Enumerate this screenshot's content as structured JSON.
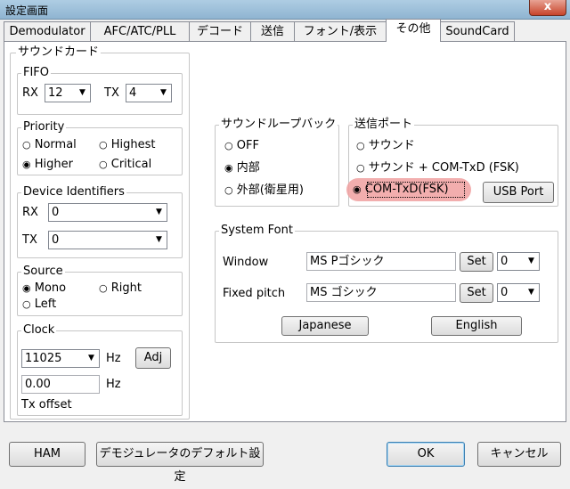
{
  "window": {
    "title": "設定画面",
    "close_glyph": "x"
  },
  "tabs": [
    "Demodulator",
    "AFC/ATC/PLL",
    "デコード",
    "送信",
    "フォント/表示",
    "その他",
    "SoundCard"
  ],
  "sound_card": {
    "legend": "サウンドカード",
    "fifo": {
      "legend": "FIFO",
      "rx_label": "RX",
      "rx_value": "12",
      "tx_label": "TX",
      "tx_value": "4"
    },
    "priority": {
      "legend": "Priority",
      "options": [
        "Normal",
        "Highest",
        "Higher",
        "Critical"
      ],
      "selected": "Higher"
    },
    "device_identifiers": {
      "legend": "Device Identifiers",
      "rx_label": "RX",
      "rx_value": "0",
      "tx_label": "TX",
      "tx_value": "0"
    },
    "source": {
      "legend": "Source",
      "options": [
        "Mono",
        "Right",
        "Left"
      ],
      "selected": "Mono"
    },
    "clock": {
      "legend": "Clock",
      "value": "11025",
      "unit": "Hz",
      "adj_label": "Adj",
      "offset_value": "0.00",
      "offset_unit": "Hz",
      "offset_label": "Tx offset"
    }
  },
  "sound_loopback": {
    "legend": "サウンドループバック",
    "options": [
      "OFF",
      "内部",
      "外部(衛星用)"
    ],
    "selected": "内部"
  },
  "tx_port": {
    "legend": "送信ポート",
    "options": [
      "サウンド",
      "サウンド + COM-TxD (FSK)",
      "COM-TxD(FSK)"
    ],
    "selected": "COM-TxD(FSK)",
    "usb_port_label": "USB Port"
  },
  "system_font": {
    "legend": "System Font",
    "window_label": "Window",
    "window_font": "MS Pゴシック",
    "window_size": "0",
    "fixed_label": "Fixed pitch",
    "fixed_font": "MS ゴシック",
    "fixed_size": "0",
    "set_label": "Set",
    "japanese_label": "Japanese",
    "english_label": "English"
  },
  "footer": {
    "ham_label": "HAM",
    "default_label": "デモジュレータのデフォルト設定",
    "ok_label": "OK",
    "cancel_label": "キャンセル"
  }
}
